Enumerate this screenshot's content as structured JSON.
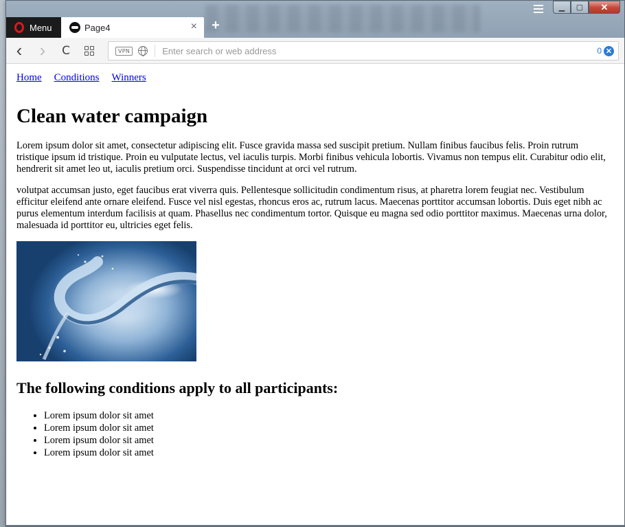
{
  "browser": {
    "menu_label": "Menu",
    "tab": {
      "title": "Page4",
      "close_glyph": "×"
    },
    "new_tab_glyph": "+",
    "toolbar": {
      "back_glyph": "‹",
      "forward_glyph": "›",
      "reload_glyph": "C",
      "vpn_label": "VPN",
      "address_placeholder": "Enter search or web address",
      "address_value": "",
      "blocked_count": "0",
      "blocked_glyph": "✕"
    },
    "window_controls": {
      "minimize": "▁",
      "maximize": "▢",
      "close": "✕"
    }
  },
  "page": {
    "nav": [
      {
        "label": "Home"
      },
      {
        "label": "Conditions"
      },
      {
        "label": "Winners"
      }
    ],
    "title": "Clean water campaign",
    "paragraphs": [
      "Lorem ipsum dolor sit amet, consectetur adipiscing elit. Fusce gravida massa sed suscipit pretium. Nullam finibus faucibus felis. Proin rutrum tristique ipsum id tristique. Proin eu vulputate lectus, vel iaculis turpis. Morbi finibus vehicula lobortis. Vivamus non tempus elit. Curabitur odio elit, hendrerit sit amet leo ut, iaculis pretium orci. Suspendisse tincidunt at orci vel rutrum.",
      "volutpat accumsan justo, eget faucibus erat viverra quis. Pellentesque sollicitudin condimentum risus, at pharetra lorem feugiat nec. Vestibulum efficitur eleifend ante ornare eleifend. Fusce vel nisl egestas, rhoncus eros ac, rutrum lacus. Maecenas porttitor accumsan lobortis. Duis eget nibh ac purus elementum interdum facilisis at quam. Phasellus nec condimentum tortor. Quisque eu magna sed odio porttitor maximus. Maecenas urna dolor, malesuada id porttitor eu, ultricies eget felis."
    ],
    "subheading": "The following conditions apply to all participants:",
    "conditions": [
      "Lorem ipsum dolor sit amet",
      "Lorem ipsum dolor sit amet",
      "Lorem ipsum dolor sit amet",
      "Lorem ipsum dolor sit amet"
    ]
  },
  "colors": {
    "link": "#0000ee",
    "opera_red": "#e0161a",
    "adblock_blue": "#2a7ad8"
  }
}
